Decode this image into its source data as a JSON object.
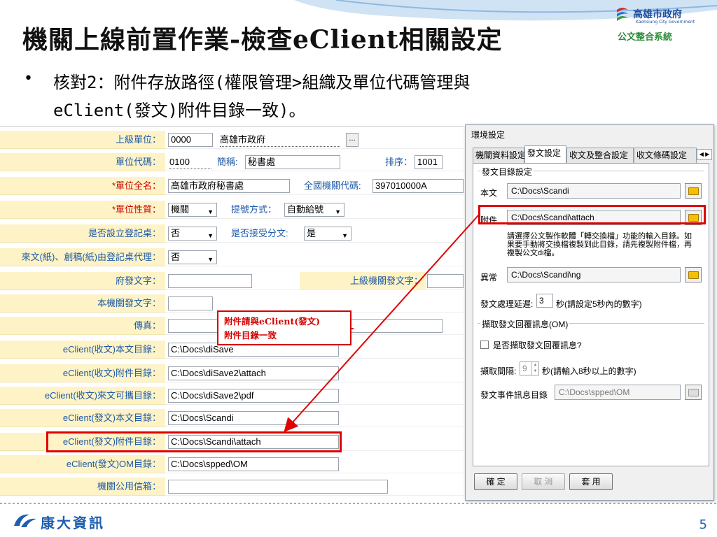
{
  "slide": {
    "title": "機關上線前置作業-檢查eClient相關設定",
    "bullet_line1": "核對2：附件存放路徑(權限管理>組織及單位代碼管理與",
    "bullet_line2": "eClient(發文)附件目錄一致)。",
    "page_number": "5"
  },
  "logo": {
    "city": "高雄市政府",
    "city_en": "Kaohsiung City Government",
    "system": "公文整合系統"
  },
  "footer": {
    "company": "康大資訊"
  },
  "form": {
    "parent_unit_label": "上級單位：",
    "parent_unit_code": "0000",
    "parent_unit_name": "高雄市政府",
    "parent_unit_btn": "...",
    "unit_code_label": "單位代碼：",
    "unit_code": "0100",
    "short_name_label": "簡稱:",
    "short_name": "秘書處",
    "order_label": "排序：",
    "order": "1001",
    "full_name_label": "*單位全名：",
    "full_name": "高雄市政府秘書處",
    "national_code_label": "全國機關代碼:",
    "national_code": "397010000A",
    "unit_type_label": "*單位性質：",
    "unit_type": "機關",
    "numbering_label": "提號方式：",
    "numbering": "自動給號",
    "reg_desk_label": "是否設立登記桌：",
    "reg_desk": "否",
    "accept_public_label": "是否接受分文:",
    "accept_public": "是",
    "proxy_label": "來文(紙)、創稿(紙)由登記桌代理：",
    "proxy": "否",
    "gov_send_label": "府發文字：",
    "upper_send_label": "上級機關發文字：",
    "own_send_label": "本機關發文字：",
    "fax_label": "傳真：",
    "recv_body_label": "eClient(收文)本文目錄：",
    "recv_body": "C:\\Docs\\diSave",
    "recv_attach_label": "eClient(收文)附件目錄：",
    "recv_attach": "C:\\Docs\\diSave2\\attach",
    "recv_portable_label": "eClient(收文)來文可攜目錄：",
    "recv_portable": "C:\\Docs\\diSave2\\pdf",
    "send_body_label": "eClient(發文)本文目錄：",
    "send_body": "C:\\Docs\\Scandi",
    "send_attach_label": "eClient(發文)附件目錄：",
    "send_attach": "C:\\Docs\\Scandi\\attach",
    "send_om_label": "eClient(發文)OM目錄：",
    "send_om": "C:\\Docs\\spped\\OM",
    "public_mail_label": "機關公用信箱："
  },
  "callout": {
    "line1": "附件請與eClient(發文)",
    "line2": "附件目錄一致"
  },
  "dialog": {
    "title": "環境設定",
    "tabs": [
      "機關資料設定",
      "發文設定",
      "收文及整合設定",
      "收文條碼設定"
    ],
    "group1_title": "發文目錄設定",
    "body_label": "本文",
    "body_path": "C:\\Docs\\Scandi",
    "attach_label": "附件",
    "attach_path": "C:\\Docs\\Scandi\\attach",
    "note": "請選擇公文製作軟體「轉交換檔」功能的輸入目錄。如果要手動將交換檔複製到此目錄，請先複製附件檔，再複製公文di檔。",
    "error_label": "異常",
    "error_path": "C:\\Docs\\Scandi\\ng",
    "delay_label": "發文處理延遲:",
    "delay_value": "3",
    "delay_unit": "秒(請設定5秒內的數字)",
    "group2_title": "擷取發文回覆訊息(OM)",
    "fetch_checkbox_label": "是否擷取發文回覆訊息?",
    "fetch_checked": false,
    "interval_label": "擷取間隔:",
    "interval_value": "9",
    "interval_unit": "秒(請輸入8秒以上的數字)",
    "event_label": "發文事件訊息目錄",
    "event_path": "C:\\Docs\\spped\\OM",
    "ok": "確 定",
    "cancel": "取 消",
    "apply": "套 用"
  },
  "colors": {
    "highlight": "#e00000",
    "label_bg": "#fdf3c6",
    "label_text": "#1e5aa8",
    "brand_blue": "#1f5fb0"
  }
}
